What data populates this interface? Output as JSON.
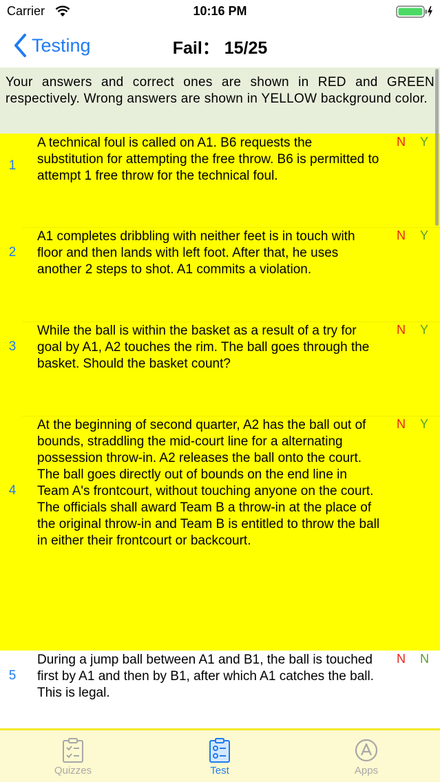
{
  "status_bar": {
    "carrier": "Carrier",
    "time": "10:16 PM"
  },
  "nav": {
    "back_label": "Testing",
    "title": "Fail：  15/25"
  },
  "instructions": "Your answers and correct ones are shown in RED and GREEN respectively. Wrong answers are shown in YELLOW background color.",
  "questions": [
    {
      "number": "1",
      "text": "A technical foul is called on A1. B6 requests the substitution for attempting the free throw. B6 is permitted to attempt 1 free throw for the technical foul.",
      "your_answer": "N",
      "correct_answer": "Y",
      "state": "wrong"
    },
    {
      "number": "2",
      "text": "A1 completes dribbling with neither feet is in touch with floor and then lands with left foot. After that, he uses another 2 steps to shot. A1 commits a violation.",
      "your_answer": "N",
      "correct_answer": "Y",
      "state": "wrong"
    },
    {
      "number": "3",
      "text": "While the ball is within the basket as a result of a try for goal by A1, A2 touches the rim. The ball goes through the basket. Should the basket count?",
      "your_answer": "N",
      "correct_answer": "Y",
      "state": "wrong"
    },
    {
      "number": "4",
      "text": "At the beginning of second quarter, A2 has the ball out of bounds, straddling the mid-court line for a alternating possession throw-in. A2 releases the ball onto the court. The ball goes directly out of bounds on the end line in Team A's frontcourt, without touching anyone on the court. The officials shall award Team B a throw-in at the place of the original throw-in and Team B is entitled to throw the ball in either their frontcourt or backcourt.",
      "your_answer": "N",
      "correct_answer": "Y",
      "state": "wrong"
    },
    {
      "number": "5",
      "text": "During a jump ball between A1 and B1, the ball is touched first by A1 and then by B1, after which A1 catches the ball. This is legal.",
      "your_answer": "N",
      "correct_answer": "N",
      "state": "correct"
    }
  ],
  "tabs": [
    {
      "label": "Quizzes",
      "icon": "quizzes-icon",
      "active": false
    },
    {
      "label": "Test",
      "icon": "test-icon",
      "active": true
    },
    {
      "label": "Apps",
      "icon": "apps-icon",
      "active": false
    }
  ],
  "colors": {
    "accent": "#1e7cf2",
    "wrong_background": "#ffff00",
    "your_answer": "#e8231b",
    "correct_answer": "#5aa02c",
    "instructions_background": "#e7efdb",
    "tab_bar_background": "#fdf9d0"
  }
}
